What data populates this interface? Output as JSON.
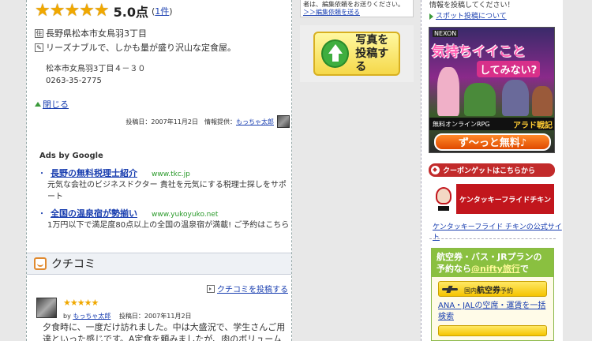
{
  "shop": {
    "stars": "★★★★★",
    "score": "5.0点",
    "count_open": "(",
    "count_link": "1件",
    "count_close": ")",
    "location": "長野県松本市女鳥羽3丁目",
    "location_icon_glyph": "住",
    "comment": "リーズナブルで、しかも量が盛り沢山な定食屋。",
    "comment_icon_glyph": "✎",
    "address_line": "松本市女鳥羽3丁目４－３０",
    "phone": "0263-35-2775",
    "close_label": "閉じる",
    "post_meta_prefix": "投稿日：2007年11月2日　情報提供：",
    "post_user": "もっちゃ太郎"
  },
  "ads": {
    "title": "Ads by Google",
    "items": [
      {
        "title": "長野の無料税理士紹介",
        "url": "www.tkc.jp",
        "desc": "元気な会社のビジネスドクター 貴社を元気にする税理士探しをサポート"
      },
      {
        "title": "全国の温泉宿が勢揃い",
        "url": "www.yukoyuko.net",
        "desc": "1万円以下で満足度80点以上の全国の温泉宿が満載! ご予約はこちら"
      }
    ]
  },
  "kuchikomi": {
    "title": "クチコミ",
    "post_label": "クチコミを投稿する",
    "review_stars": "★★★★★",
    "review_by": "by",
    "review_user": "もっちゃ太郎",
    "review_date": "　投稿日：2007年11月2日",
    "review_text": "夕食時に、一度だけ訪れました。中は大盛況で、学生さんご用達といった感じです。A定食を頼みましたが、肉のボリュームがすごくて、しかもご"
  },
  "middle": {
    "top_text": "者は、編集依頼をお送りください。",
    "top_link": "＞＞編集依頼を送る",
    "photo_label": "写真を投稿する"
  },
  "right": {
    "top_text": "情報を投稿してください！",
    "spot_link": "スポット投稿について",
    "game": {
      "brand": "NEXON",
      "headline": "気持ちイイこと",
      "sub": "してみない?",
      "foot_left": "無料オンラインRPG",
      "foot_right": "アラド戦記",
      "cta": "ず～っと無料♪"
    },
    "coupon_label": "クーポンゲットはこちらから",
    "kfc_label": "ケンタッキーフライドチキン",
    "kfc_link": "ケンタッキーフライド チキンの公式サイト",
    "travel_head_1": "航空券・バス・JRプランの予約なら",
    "travel_head_link": "@nifty旅行",
    "travel_head_2": "で",
    "domestic_small": "国内",
    "domestic_big": "航空券",
    "domestic_suffix": "予約",
    "travel_link": "ANA・JALの空席・運賃を一括検索"
  },
  "colors": {
    "star": "#f0a800",
    "link": "#1a3fb0",
    "ad_url": "#2a9a2a",
    "travel_green": "#8ac040",
    "kfc_red": "#c2161d"
  }
}
